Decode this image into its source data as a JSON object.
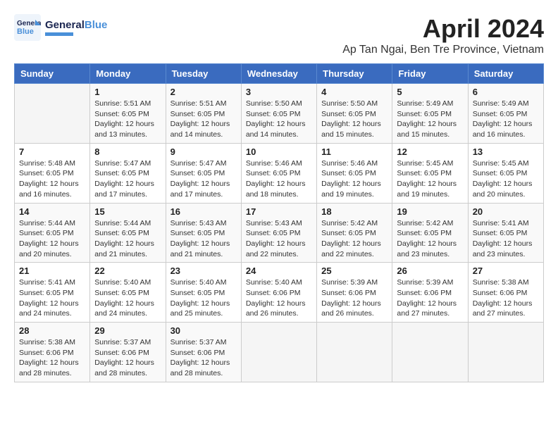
{
  "logo": {
    "text_general": "General",
    "text_blue": "Blue"
  },
  "title": "April 2024",
  "subtitle": "Ap Tan Ngai, Ben Tre Province, Vietnam",
  "days_of_week": [
    "Sunday",
    "Monday",
    "Tuesday",
    "Wednesday",
    "Thursday",
    "Friday",
    "Saturday"
  ],
  "weeks": [
    [
      {
        "day": "",
        "info": ""
      },
      {
        "day": "1",
        "info": "Sunrise: 5:51 AM\nSunset: 6:05 PM\nDaylight: 12 hours\nand 13 minutes."
      },
      {
        "day": "2",
        "info": "Sunrise: 5:51 AM\nSunset: 6:05 PM\nDaylight: 12 hours\nand 14 minutes."
      },
      {
        "day": "3",
        "info": "Sunrise: 5:50 AM\nSunset: 6:05 PM\nDaylight: 12 hours\nand 14 minutes."
      },
      {
        "day": "4",
        "info": "Sunrise: 5:50 AM\nSunset: 6:05 PM\nDaylight: 12 hours\nand 15 minutes."
      },
      {
        "day": "5",
        "info": "Sunrise: 5:49 AM\nSunset: 6:05 PM\nDaylight: 12 hours\nand 15 minutes."
      },
      {
        "day": "6",
        "info": "Sunrise: 5:49 AM\nSunset: 6:05 PM\nDaylight: 12 hours\nand 16 minutes."
      }
    ],
    [
      {
        "day": "7",
        "info": "Sunrise: 5:48 AM\nSunset: 6:05 PM\nDaylight: 12 hours\nand 16 minutes."
      },
      {
        "day": "8",
        "info": "Sunrise: 5:47 AM\nSunset: 6:05 PM\nDaylight: 12 hours\nand 17 minutes."
      },
      {
        "day": "9",
        "info": "Sunrise: 5:47 AM\nSunset: 6:05 PM\nDaylight: 12 hours\nand 17 minutes."
      },
      {
        "day": "10",
        "info": "Sunrise: 5:46 AM\nSunset: 6:05 PM\nDaylight: 12 hours\nand 18 minutes."
      },
      {
        "day": "11",
        "info": "Sunrise: 5:46 AM\nSunset: 6:05 PM\nDaylight: 12 hours\nand 19 minutes."
      },
      {
        "day": "12",
        "info": "Sunrise: 5:45 AM\nSunset: 6:05 PM\nDaylight: 12 hours\nand 19 minutes."
      },
      {
        "day": "13",
        "info": "Sunrise: 5:45 AM\nSunset: 6:05 PM\nDaylight: 12 hours\nand 20 minutes."
      }
    ],
    [
      {
        "day": "14",
        "info": "Sunrise: 5:44 AM\nSunset: 6:05 PM\nDaylight: 12 hours\nand 20 minutes."
      },
      {
        "day": "15",
        "info": "Sunrise: 5:44 AM\nSunset: 6:05 PM\nDaylight: 12 hours\nand 21 minutes."
      },
      {
        "day": "16",
        "info": "Sunrise: 5:43 AM\nSunset: 6:05 PM\nDaylight: 12 hours\nand 21 minutes."
      },
      {
        "day": "17",
        "info": "Sunrise: 5:43 AM\nSunset: 6:05 PM\nDaylight: 12 hours\nand 22 minutes."
      },
      {
        "day": "18",
        "info": "Sunrise: 5:42 AM\nSunset: 6:05 PM\nDaylight: 12 hours\nand 22 minutes."
      },
      {
        "day": "19",
        "info": "Sunrise: 5:42 AM\nSunset: 6:05 PM\nDaylight: 12 hours\nand 23 minutes."
      },
      {
        "day": "20",
        "info": "Sunrise: 5:41 AM\nSunset: 6:05 PM\nDaylight: 12 hours\nand 23 minutes."
      }
    ],
    [
      {
        "day": "21",
        "info": "Sunrise: 5:41 AM\nSunset: 6:05 PM\nDaylight: 12 hours\nand 24 minutes."
      },
      {
        "day": "22",
        "info": "Sunrise: 5:40 AM\nSunset: 6:05 PM\nDaylight: 12 hours\nand 24 minutes."
      },
      {
        "day": "23",
        "info": "Sunrise: 5:40 AM\nSunset: 6:05 PM\nDaylight: 12 hours\nand 25 minutes."
      },
      {
        "day": "24",
        "info": "Sunrise: 5:40 AM\nSunset: 6:06 PM\nDaylight: 12 hours\nand 26 minutes."
      },
      {
        "day": "25",
        "info": "Sunrise: 5:39 AM\nSunset: 6:06 PM\nDaylight: 12 hours\nand 26 minutes."
      },
      {
        "day": "26",
        "info": "Sunrise: 5:39 AM\nSunset: 6:06 PM\nDaylight: 12 hours\nand 27 minutes."
      },
      {
        "day": "27",
        "info": "Sunrise: 5:38 AM\nSunset: 6:06 PM\nDaylight: 12 hours\nand 27 minutes."
      }
    ],
    [
      {
        "day": "28",
        "info": "Sunrise: 5:38 AM\nSunset: 6:06 PM\nDaylight: 12 hours\nand 28 minutes."
      },
      {
        "day": "29",
        "info": "Sunrise: 5:37 AM\nSunset: 6:06 PM\nDaylight: 12 hours\nand 28 minutes."
      },
      {
        "day": "30",
        "info": "Sunrise: 5:37 AM\nSunset: 6:06 PM\nDaylight: 12 hours\nand 28 minutes."
      },
      {
        "day": "",
        "info": ""
      },
      {
        "day": "",
        "info": ""
      },
      {
        "day": "",
        "info": ""
      },
      {
        "day": "",
        "info": ""
      }
    ]
  ]
}
